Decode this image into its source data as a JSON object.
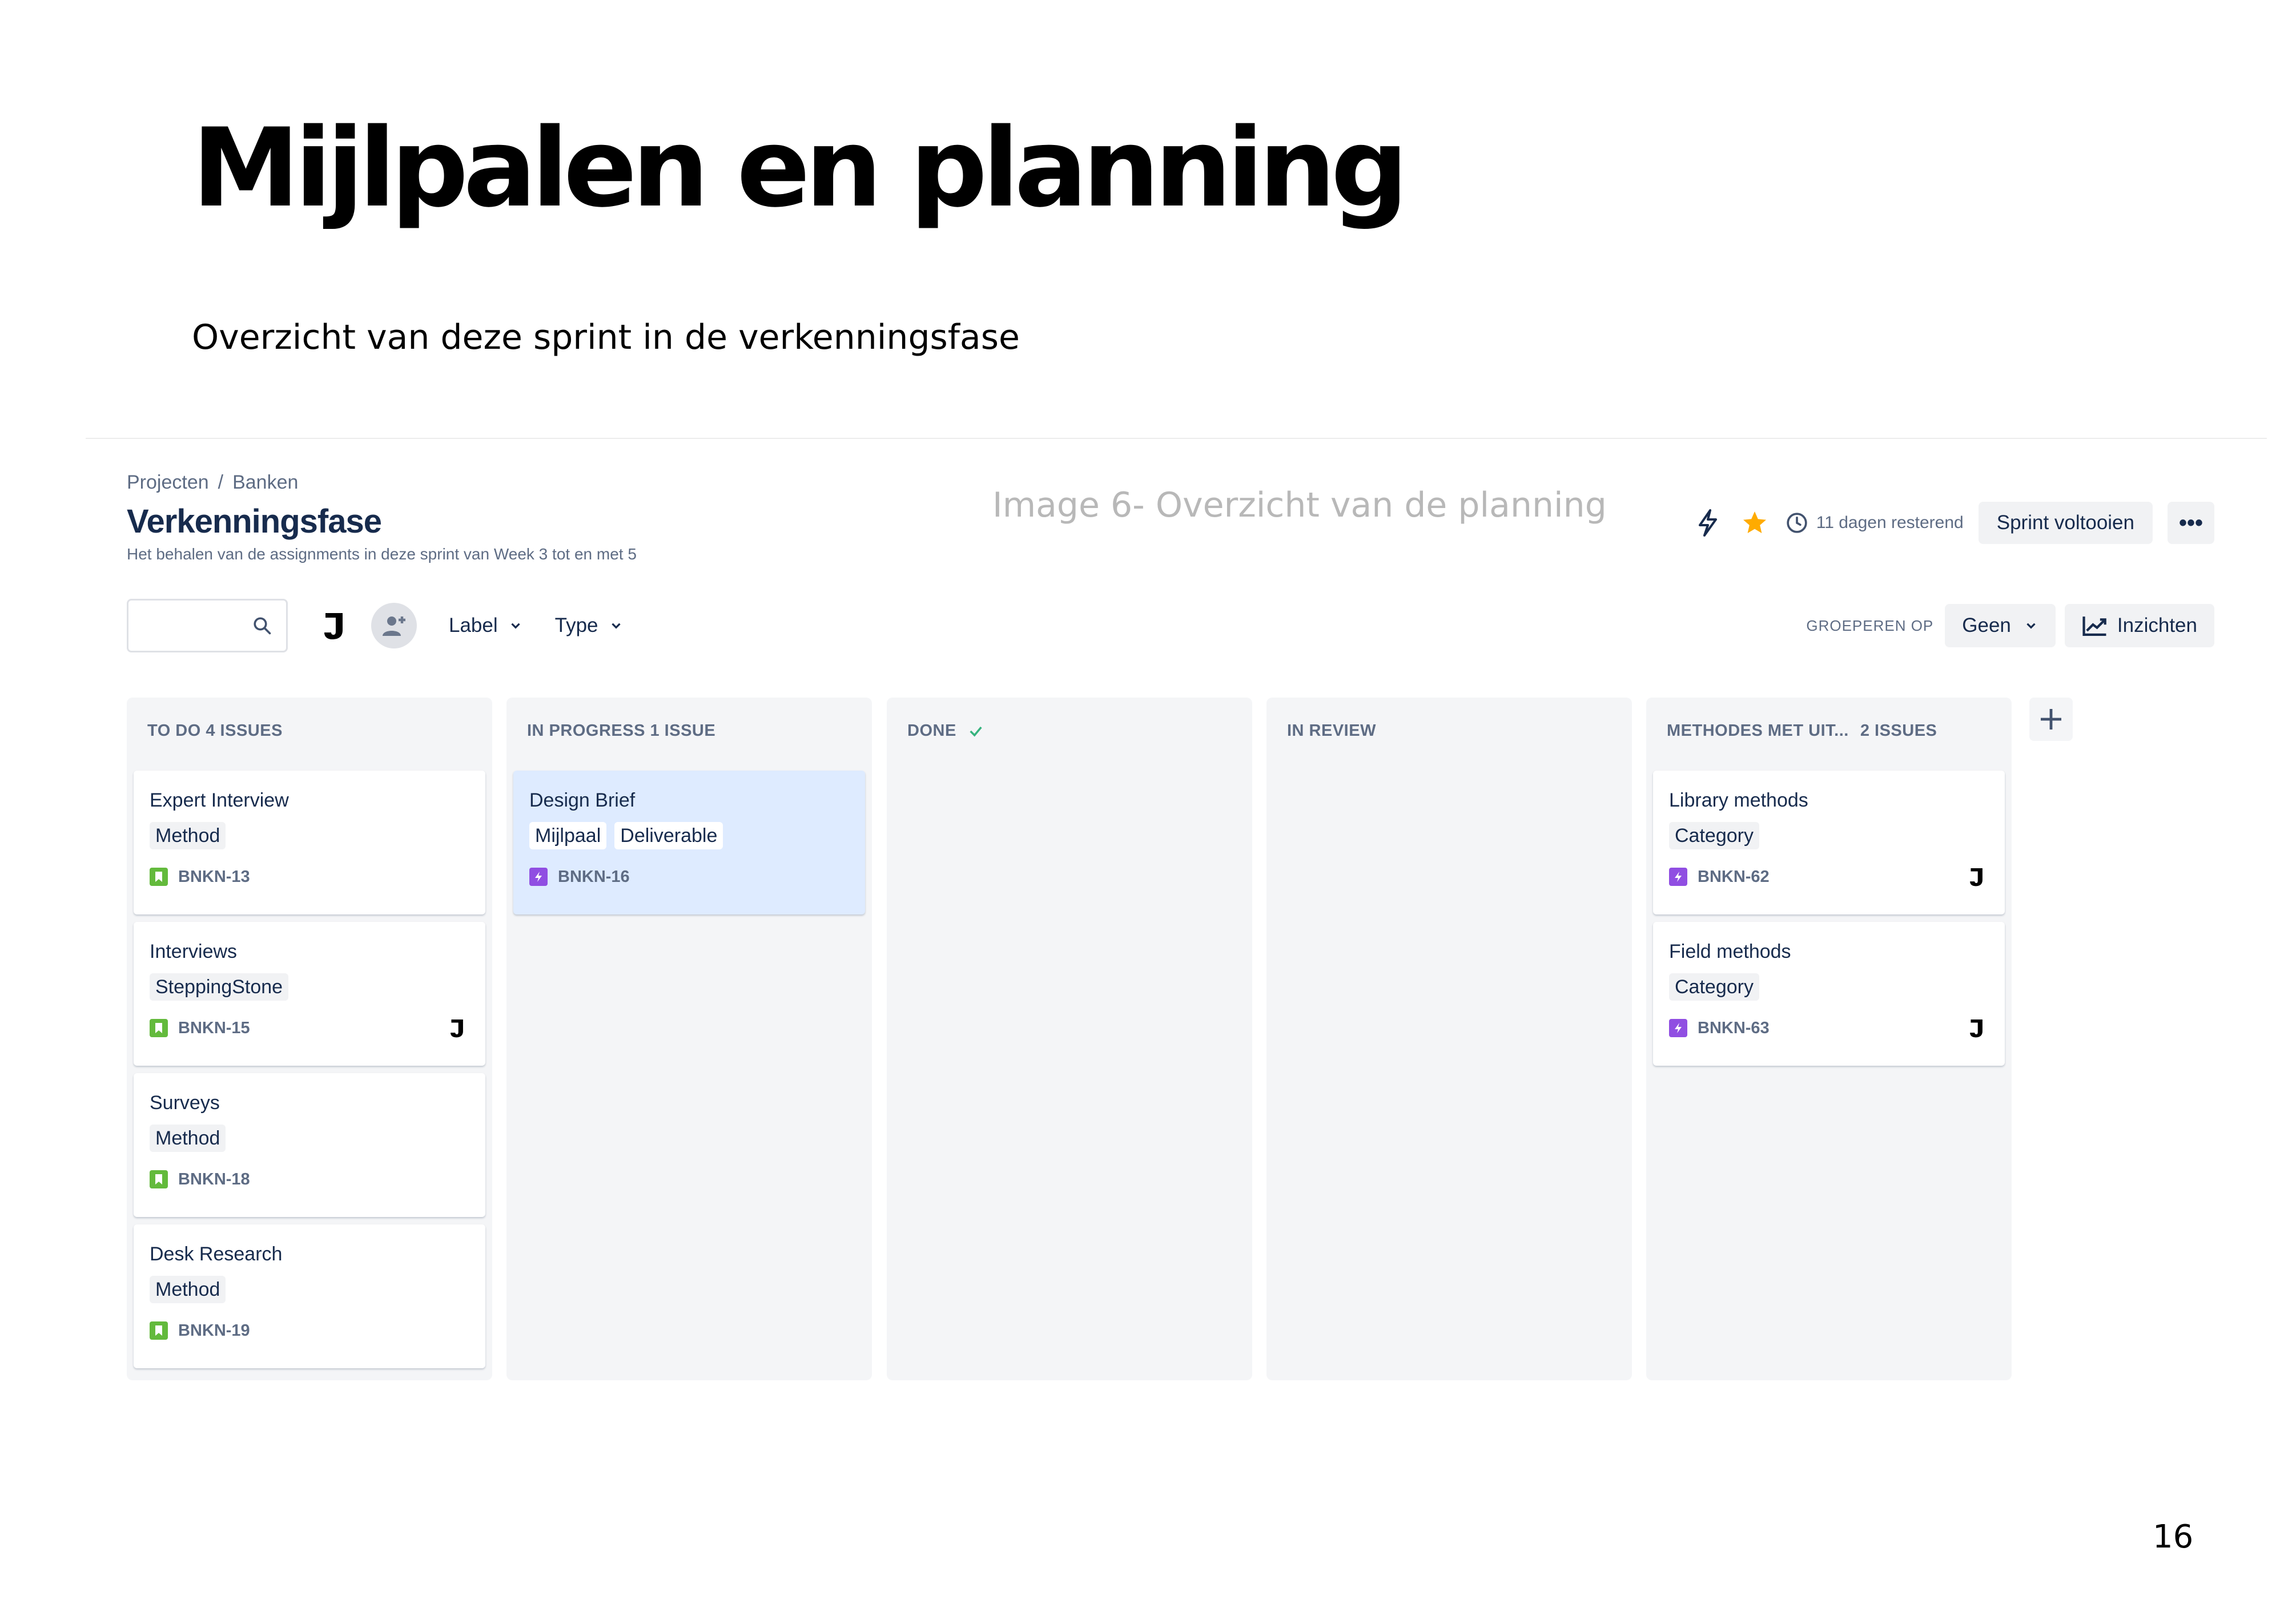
{
  "slide": {
    "title": "Mijlpalen en planning",
    "subtitle": "Overzicht van deze sprint in de verkenningsfase",
    "caption": "Image 6- Overzicht van de planning",
    "page_number": "16"
  },
  "jira": {
    "breadcrumb": [
      "Projecten",
      "/",
      "Banken"
    ],
    "page_title": "Verkenningsfase",
    "description": "Het behalen van de assignments in deze sprint van Week 3 tot en met 5",
    "time_remaining": "11 dagen resterend",
    "complete_sprint": "Sprint voltooien",
    "more": "•••",
    "filters": {
      "label": "Label",
      "type": "Type"
    },
    "group_by_label": "GROEPEREN OP",
    "group_by_value": "Geen",
    "insights": "Inzichten",
    "avatar_letter": "J",
    "colors": {
      "story": "#63ba3c",
      "epic": "#904ee2",
      "star": "#ffab00",
      "done_check": "#36b37e",
      "highlight": "#deebff"
    },
    "columns": [
      {
        "name": "TO DO 4 ISSUES",
        "cards": [
          {
            "title": "Expert Interview",
            "labels": [
              "Method"
            ],
            "type": "story",
            "key": "BNKN-13",
            "assignee": ""
          },
          {
            "title": "Interviews",
            "labels": [
              "SteppingStone"
            ],
            "type": "story",
            "key": "BNKN-15",
            "assignee": "J"
          },
          {
            "title": "Surveys",
            "labels": [
              "Method"
            ],
            "type": "story",
            "key": "BNKN-18",
            "assignee": ""
          },
          {
            "title": "Desk Research",
            "labels": [
              "Method"
            ],
            "type": "story",
            "key": "BNKN-19",
            "assignee": ""
          }
        ]
      },
      {
        "name": "IN PROGRESS 1 ISSUE",
        "cards": [
          {
            "title": "Design Brief",
            "labels": [
              "Mijlpaal",
              "Deliverable"
            ],
            "type": "epic",
            "key": "BNKN-16",
            "assignee": ""
          }
        ]
      },
      {
        "name": "DONE",
        "cards": []
      },
      {
        "name": "IN REVIEW",
        "cards": []
      },
      {
        "name": "METHODES MET UIT...",
        "count": "2 ISSUES",
        "cards": [
          {
            "title": "Library methods",
            "labels": [
              "Category"
            ],
            "type": "epic",
            "key": "BNKN-62",
            "assignee": "J"
          },
          {
            "title": "Field methods",
            "labels": [
              "Category"
            ],
            "type": "epic",
            "key": "BNKN-63",
            "assignee": "J"
          }
        ]
      }
    ]
  }
}
